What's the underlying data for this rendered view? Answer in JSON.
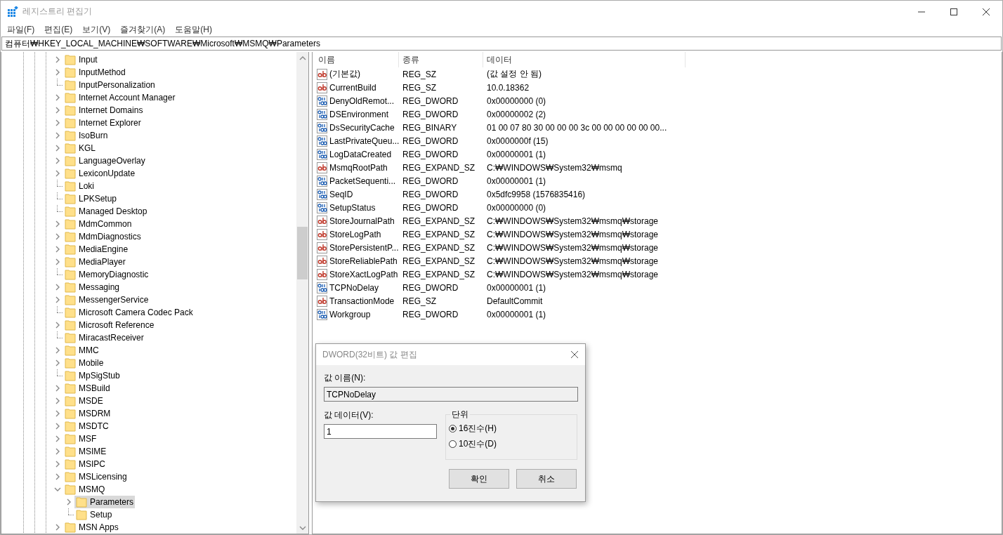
{
  "window": {
    "title": "레지스트리 편집기"
  },
  "menu": [
    "파일(F)",
    "편집(E)",
    "보기(V)",
    "즐겨찾기(A)",
    "도움말(H)"
  ],
  "address": "컴퓨터₩HKEY_LOCAL_MACHINE₩SOFTWARE₩Microsoft₩MSMQ₩Parameters",
  "tree": [
    {
      "label": "Input",
      "expandable": true,
      "expanded": false,
      "selected": false
    },
    {
      "label": "InputMethod",
      "expandable": true,
      "expanded": false,
      "selected": false
    },
    {
      "label": "InputPersonalization",
      "expandable": false,
      "selected": false
    },
    {
      "label": "Internet Account Manager",
      "expandable": true,
      "expanded": false,
      "selected": false
    },
    {
      "label": "Internet Domains",
      "expandable": true,
      "expanded": false,
      "selected": false
    },
    {
      "label": "Internet Explorer",
      "expandable": true,
      "expanded": false,
      "selected": false
    },
    {
      "label": "IsoBurn",
      "expandable": true,
      "expanded": false,
      "selected": false
    },
    {
      "label": "KGL",
      "expandable": true,
      "expanded": false,
      "selected": false
    },
    {
      "label": "LanguageOverlay",
      "expandable": true,
      "expanded": false,
      "selected": false
    },
    {
      "label": "LexiconUpdate",
      "expandable": true,
      "expanded": false,
      "selected": false
    },
    {
      "label": "Loki",
      "expandable": false,
      "selected": false
    },
    {
      "label": "LPKSetup",
      "expandable": false,
      "selected": false
    },
    {
      "label": "Managed Desktop",
      "expandable": false,
      "selected": false
    },
    {
      "label": "MdmCommon",
      "expandable": true,
      "expanded": false,
      "selected": false
    },
    {
      "label": "MdmDiagnostics",
      "expandable": true,
      "expanded": false,
      "selected": false
    },
    {
      "label": "MediaEngine",
      "expandable": true,
      "expanded": false,
      "selected": false
    },
    {
      "label": "MediaPlayer",
      "expandable": true,
      "expanded": false,
      "selected": false
    },
    {
      "label": "MemoryDiagnostic",
      "expandable": false,
      "selected": false
    },
    {
      "label": "Messaging",
      "expandable": true,
      "expanded": false,
      "selected": false
    },
    {
      "label": "MessengerService",
      "expandable": true,
      "expanded": false,
      "selected": false
    },
    {
      "label": "Microsoft Camera Codec Pack",
      "expandable": false,
      "selected": false
    },
    {
      "label": "Microsoft Reference",
      "expandable": true,
      "expanded": false,
      "selected": false
    },
    {
      "label": "MiracastReceiver",
      "expandable": false,
      "selected": false
    },
    {
      "label": "MMC",
      "expandable": true,
      "expanded": false,
      "selected": false
    },
    {
      "label": "Mobile",
      "expandable": true,
      "expanded": false,
      "selected": false
    },
    {
      "label": "MpSigStub",
      "expandable": false,
      "selected": false
    },
    {
      "label": "MSBuild",
      "expandable": true,
      "expanded": false,
      "selected": false
    },
    {
      "label": "MSDE",
      "expandable": true,
      "expanded": false,
      "selected": false
    },
    {
      "label": "MSDRM",
      "expandable": true,
      "expanded": false,
      "selected": false
    },
    {
      "label": "MSDTC",
      "expandable": true,
      "expanded": false,
      "selected": false
    },
    {
      "label": "MSF",
      "expandable": true,
      "expanded": false,
      "selected": false
    },
    {
      "label": "MSIME",
      "expandable": true,
      "expanded": false,
      "selected": false
    },
    {
      "label": "MSIPC",
      "expandable": true,
      "expanded": false,
      "selected": false
    },
    {
      "label": "MSLicensing",
      "expandable": true,
      "expanded": false,
      "selected": false
    },
    {
      "label": "MSMQ",
      "expandable": true,
      "expanded": true,
      "selected": false,
      "children": [
        {
          "label": "Parameters",
          "expandable": true,
          "expanded": false,
          "selected": true
        },
        {
          "label": "Setup",
          "expandable": false,
          "selected": false
        }
      ]
    },
    {
      "label": "MSN Apps",
      "expandable": true,
      "expanded": false,
      "selected": false
    }
  ],
  "columns": [
    "이름",
    "종류",
    "데이터"
  ],
  "values": [
    {
      "kind": "string",
      "name": "(기본값)",
      "type": "REG_SZ",
      "data": "(값 설정 안 됨)"
    },
    {
      "kind": "string",
      "name": "CurrentBuild",
      "type": "REG_SZ",
      "data": "10.0.18362"
    },
    {
      "kind": "binary",
      "name": "DenyOldRemot...",
      "type": "REG_DWORD",
      "data": "0x00000000 (0)"
    },
    {
      "kind": "binary",
      "name": "DSEnvironment",
      "type": "REG_DWORD",
      "data": "0x00000002 (2)"
    },
    {
      "kind": "binary",
      "name": "DsSecurityCache",
      "type": "REG_BINARY",
      "data": "01 00 07 80 30 00 00 00 3c 00 00 00 00 00 00..."
    },
    {
      "kind": "binary",
      "name": "LastPrivateQueu...",
      "type": "REG_DWORD",
      "data": "0x0000000f (15)"
    },
    {
      "kind": "binary",
      "name": "LogDataCreated",
      "type": "REG_DWORD",
      "data": "0x00000001 (1)"
    },
    {
      "kind": "string",
      "name": "MsmqRootPath",
      "type": "REG_EXPAND_SZ",
      "data": "C:₩WINDOWS₩System32₩msmq"
    },
    {
      "kind": "binary",
      "name": "PacketSequenti...",
      "type": "REG_DWORD",
      "data": "0x00000001 (1)"
    },
    {
      "kind": "binary",
      "name": "SeqID",
      "type": "REG_DWORD",
      "data": "0x5dfc9958 (1576835416)"
    },
    {
      "kind": "binary",
      "name": "SetupStatus",
      "type": "REG_DWORD",
      "data": "0x00000000 (0)"
    },
    {
      "kind": "string",
      "name": "StoreJournalPath",
      "type": "REG_EXPAND_SZ",
      "data": "C:₩WINDOWS₩System32₩msmq₩storage"
    },
    {
      "kind": "string",
      "name": "StoreLogPath",
      "type": "REG_EXPAND_SZ",
      "data": "C:₩WINDOWS₩System32₩msmq₩storage"
    },
    {
      "kind": "string",
      "name": "StorePersistentP...",
      "type": "REG_EXPAND_SZ",
      "data": "C:₩WINDOWS₩System32₩msmq₩storage"
    },
    {
      "kind": "string",
      "name": "StoreReliablePath",
      "type": "REG_EXPAND_SZ",
      "data": "C:₩WINDOWS₩System32₩msmq₩storage"
    },
    {
      "kind": "string",
      "name": "StoreXactLogPath",
      "type": "REG_EXPAND_SZ",
      "data": "C:₩WINDOWS₩System32₩msmq₩storage"
    },
    {
      "kind": "binary",
      "name": "TCPNoDelay",
      "type": "REG_DWORD",
      "data": "0x00000001 (1)"
    },
    {
      "kind": "string",
      "name": "TransactionMode",
      "type": "REG_SZ",
      "data": "DefaultCommit"
    },
    {
      "kind": "binary",
      "name": "Workgroup",
      "type": "REG_DWORD",
      "data": "0x00000001 (1)"
    }
  ],
  "dialog": {
    "title": "DWORD(32비트) 값 편집",
    "name_label": "값 이름(N):",
    "name_value": "TCPNoDelay",
    "data_label": "값 데이터(V):",
    "data_value": "1",
    "unit_label": "단위",
    "units": [
      {
        "label": "16진수(H)",
        "selected": true
      },
      {
        "label": "10진수(D)",
        "selected": false
      }
    ],
    "buttons": [
      "확인",
      "취소"
    ]
  }
}
